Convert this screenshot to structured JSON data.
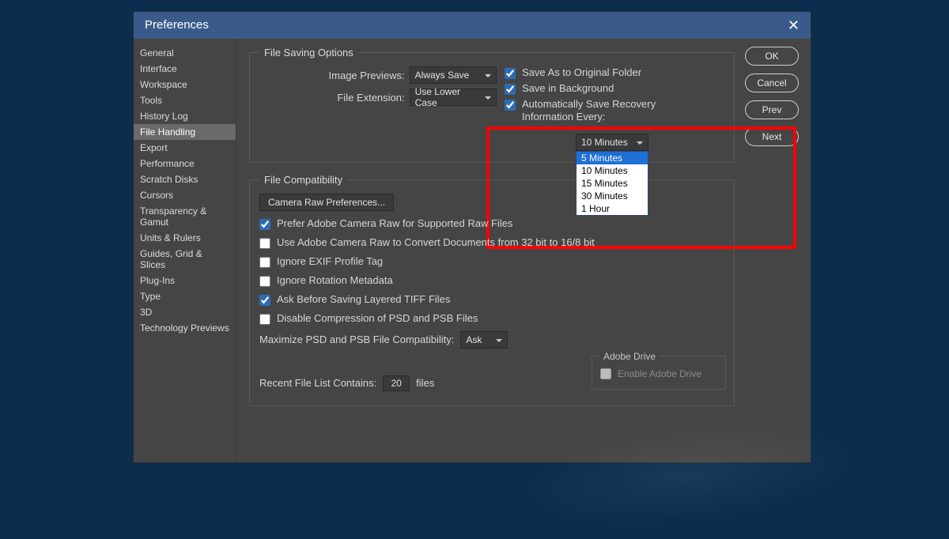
{
  "title": "Preferences",
  "sidebar": {
    "items": [
      "General",
      "Interface",
      "Workspace",
      "Tools",
      "History Log",
      "File Handling",
      "Export",
      "Performance",
      "Scratch Disks",
      "Cursors",
      "Transparency & Gamut",
      "Units & Rulers",
      "Guides, Grid & Slices",
      "Plug-Ins",
      "Type",
      "3D",
      "Technology Previews"
    ],
    "active_index": 5
  },
  "buttons": {
    "ok": "OK",
    "cancel": "Cancel",
    "prev": "Prev",
    "next": "Next"
  },
  "file_saving": {
    "legend": "File Saving Options",
    "image_previews_label": "Image Previews:",
    "image_previews_value": "Always Save",
    "file_extension_label": "File Extension:",
    "file_extension_value": "Use Lower Case",
    "save_as_original": {
      "checked": true,
      "label": "Save As to Original Folder"
    },
    "save_in_background": {
      "checked": true,
      "label": "Save in Background"
    },
    "autosave": {
      "checked": true,
      "label": "Automatically Save Recovery Information Every:",
      "value": "10 Minutes",
      "options": [
        "5 Minutes",
        "10 Minutes",
        "15 Minutes",
        "30 Minutes",
        "1 Hour"
      ],
      "highlighted_index": 0
    }
  },
  "file_compat": {
    "legend": "File Compatibility",
    "camera_raw_btn": "Camera Raw Preferences...",
    "prefer_acr": {
      "checked": true,
      "label": "Prefer Adobe Camera Raw for Supported Raw Files"
    },
    "use_acr_convert": {
      "checked": false,
      "label": "Use Adobe Camera Raw to Convert Documents from 32 bit to 16/8 bit"
    },
    "ignore_exif": {
      "checked": false,
      "label": "Ignore EXIF Profile Tag"
    },
    "ignore_rotation": {
      "checked": false,
      "label": "Ignore Rotation Metadata"
    },
    "ask_tiff": {
      "checked": true,
      "label": "Ask Before Saving Layered TIFF Files"
    },
    "disable_psd_comp": {
      "checked": false,
      "label": "Disable Compression of PSD and PSB Files"
    },
    "maximize_label": "Maximize PSD and PSB File Compatibility:",
    "maximize_value": "Ask"
  },
  "recent": {
    "label": "Recent File List Contains:",
    "value": "20",
    "suffix": "files"
  },
  "adobe_drive": {
    "legend": "Adobe Drive",
    "enable": {
      "checked": false,
      "label": "Enable Adobe Drive"
    }
  }
}
